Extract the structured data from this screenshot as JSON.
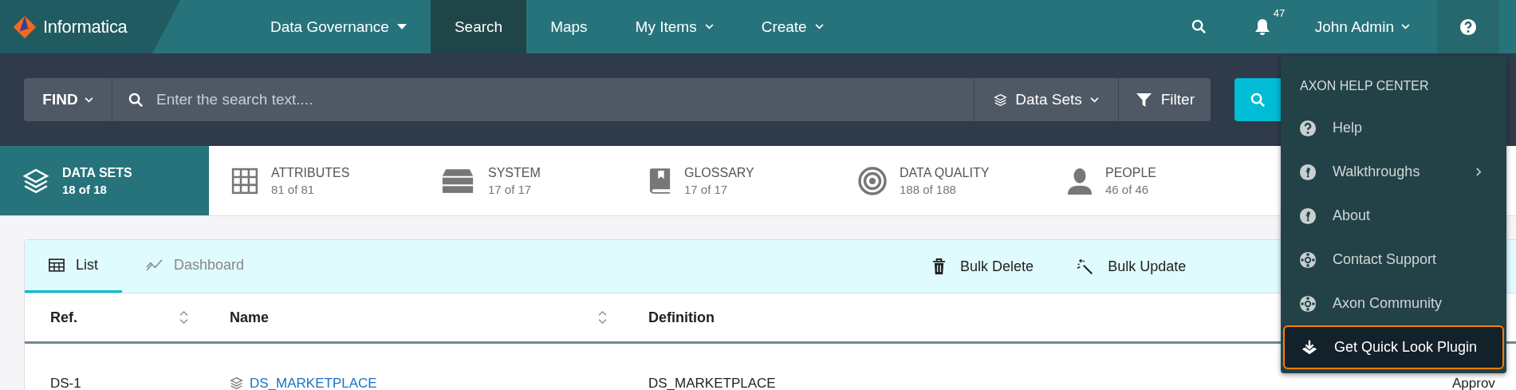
{
  "app": {
    "logo": "Informatica"
  },
  "nav": [
    {
      "label": "Data Governance",
      "kind": "dropdown",
      "selected": false
    },
    {
      "label": "Search",
      "kind": "link",
      "selected": true
    },
    {
      "label": "Maps",
      "kind": "link",
      "selected": false
    },
    {
      "label": "My Items",
      "kind": "menu",
      "selected": false
    },
    {
      "label": "Create",
      "kind": "menu",
      "selected": false
    }
  ],
  "header": {
    "notification_count": "47",
    "user": "John Admin"
  },
  "search": {
    "scope": "FIND",
    "placeholder": "Enter the search text....",
    "type_filter": "Data Sets",
    "filter": "Filter"
  },
  "categories": [
    {
      "label": "DATA SETS",
      "count": "18 of 18",
      "selected": true
    },
    {
      "label": "ATTRIBUTES",
      "count": "81 of 81",
      "selected": false
    },
    {
      "label": "SYSTEM",
      "count": "17 of 17",
      "selected": false
    },
    {
      "label": "GLOSSARY",
      "count": "17 of 17",
      "selected": false
    },
    {
      "label": "DATA QUALITY",
      "count": "188 of 188",
      "selected": false
    },
    {
      "label": "PEOPLE",
      "count": "46 of 46",
      "selected": false
    }
  ],
  "view_tabs": [
    {
      "label": "List",
      "selected": true
    },
    {
      "label": "Dashboard",
      "selected": false
    }
  ],
  "actions": [
    {
      "label": "Bulk Delete"
    },
    {
      "label": "Bulk Update"
    }
  ],
  "table": {
    "columns": [
      {
        "label": "Ref.",
        "sortable": true
      },
      {
        "label": "Name",
        "sortable": true
      },
      {
        "label": "Definition",
        "sortable": false
      }
    ],
    "rows": [
      {
        "cells": [
          "DS-1",
          "DS_MARKETPLACE",
          "DS_MARKETPLACE",
          "Approv"
        ]
      }
    ]
  },
  "help_menu": {
    "title": "AXON HELP CENTER",
    "items": [
      {
        "label": "Help",
        "submenu": false,
        "highlighted": false
      },
      {
        "label": "Walkthroughs",
        "submenu": true,
        "highlighted": false
      },
      {
        "label": "About",
        "submenu": false,
        "highlighted": false
      },
      {
        "label": "Contact Support",
        "submenu": false,
        "highlighted": false
      },
      {
        "label": "Axon Community",
        "submenu": false,
        "highlighted": false
      },
      {
        "label": "Get Quick Look Plugin",
        "submenu": false,
        "highlighted": true
      }
    ]
  }
}
